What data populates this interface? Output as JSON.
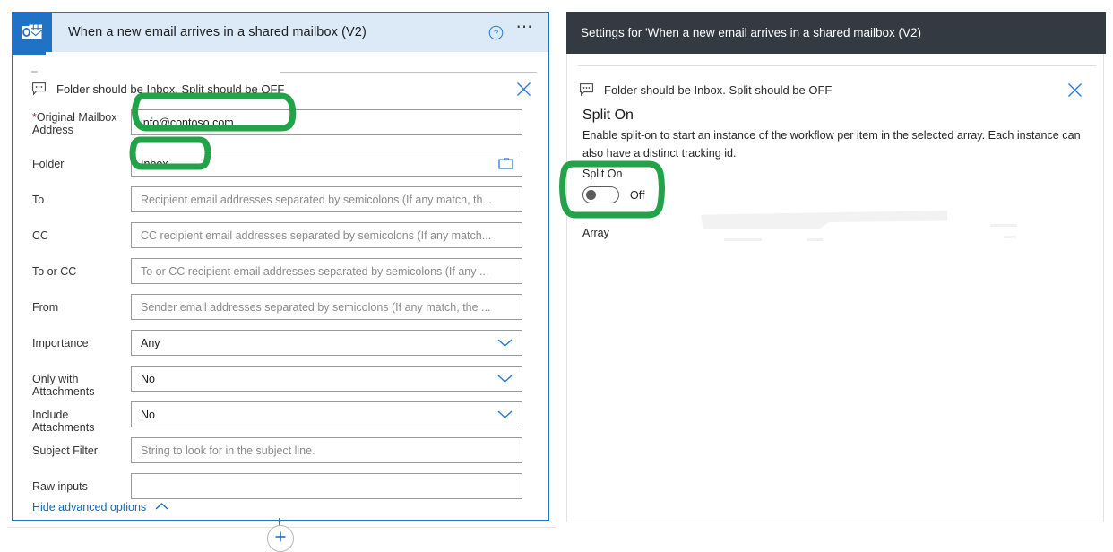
{
  "accent": {
    "brand_blue": "#1f72c4",
    "header_blue": "#dce9f7",
    "panel_dark": "#333a42",
    "annotation_green": "#22a34a",
    "required_red": "#a4262c",
    "link_blue": "#1267b5"
  },
  "trigger_card": {
    "title": "When a new email arrives in a shared mailbox (V2)",
    "app_icon": "outlook-icon",
    "help_icon": "help-circle-icon",
    "more_icon": "ellipsis-icon",
    "comment": {
      "icon": "comment-bubble-icon",
      "text": "Folder should be Inbox. Split should be OFF",
      "close_icon": "close-icon"
    },
    "fields": [
      {
        "label": "Original Mailbox Address",
        "required": true,
        "value": "info@contoso.com",
        "placeholder": "",
        "control": "text",
        "name": "original-mailbox-address"
      },
      {
        "label": "Folder",
        "required": false,
        "value": "Inbox",
        "placeholder": "",
        "control": "picker",
        "icon": "folder-picker-icon",
        "name": "folder"
      },
      {
        "label": "To",
        "required": false,
        "value": "",
        "placeholder": "Recipient email addresses separated by semicolons (If any match, th...",
        "control": "text",
        "name": "to"
      },
      {
        "label": "CC",
        "required": false,
        "value": "",
        "placeholder": "CC recipient email addresses separated by semicolons (If any match...",
        "control": "text",
        "name": "cc"
      },
      {
        "label": "To or CC",
        "required": false,
        "value": "",
        "placeholder": "To or CC recipient email addresses separated by semicolons (If any ...",
        "control": "text",
        "name": "to-or-cc"
      },
      {
        "label": "From",
        "required": false,
        "value": "",
        "placeholder": "Sender email addresses separated by semicolons (If any match, the ...",
        "control": "text",
        "name": "from"
      },
      {
        "label": "Importance",
        "required": false,
        "value": "Any",
        "placeholder": "",
        "control": "select",
        "icon": "chevron-down-icon",
        "name": "importance"
      },
      {
        "label": "Only with Attachments",
        "required": false,
        "value": "No",
        "placeholder": "",
        "control": "select",
        "icon": "chevron-down-icon",
        "name": "only-with-attachments"
      },
      {
        "label": "Include Attachments",
        "required": false,
        "value": "No",
        "placeholder": "",
        "control": "select",
        "icon": "chevron-down-icon",
        "name": "include-attachments"
      },
      {
        "label": "Subject Filter",
        "required": false,
        "value": "",
        "placeholder": "String to look for in the subject line.",
        "control": "text",
        "name": "subject-filter"
      },
      {
        "label": "Raw inputs",
        "required": false,
        "value": "",
        "placeholder": "",
        "control": "text",
        "name": "raw-inputs"
      }
    ],
    "advanced_toggle": {
      "label": "Hide advanced options",
      "icon": "chevron-up-icon"
    },
    "add_step": {
      "icon": "plus-icon"
    }
  },
  "settings_panel": {
    "title": "Settings for 'When a new email arrives in a shared mailbox (V2)",
    "comment": {
      "icon": "comment-bubble-icon",
      "text": "Folder should be Inbox. Split should be OFF",
      "close_icon": "close-icon"
    },
    "split_on": {
      "heading": "Split On",
      "description": "Enable split-on to start an instance of the workflow per item in the selected array. Each instance can also have a distinct tracking id.",
      "toggle_label": "Split On",
      "toggle_state": "Off",
      "array_label": "Array"
    }
  },
  "annotations": [
    {
      "name": "highlight-mailbox-address",
      "shape": "rounded-rect-marker"
    },
    {
      "name": "highlight-folder-inbox",
      "shape": "rounded-rect-marker"
    },
    {
      "name": "highlight-split-on-toggle",
      "shape": "rounded-rect-marker"
    }
  ]
}
